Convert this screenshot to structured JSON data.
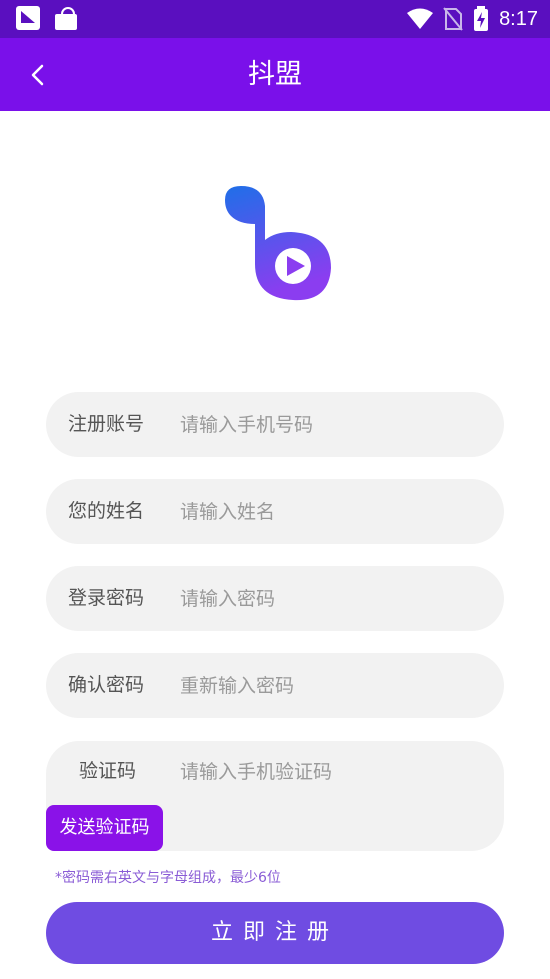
{
  "status_bar": {
    "time": "8:17",
    "left_icons": [
      "app-notification-icon",
      "shopping-bag-icon"
    ],
    "right_icons": [
      "wifi-icon",
      "no-sim-icon",
      "battery-charging-icon"
    ]
  },
  "header": {
    "title": "抖盟",
    "back_icon": "chevron-left-icon"
  },
  "form": {
    "account": {
      "label": "注册账号",
      "placeholder": "请输入手机号码",
      "value": ""
    },
    "name": {
      "label": "您的姓名",
      "placeholder": "请输入姓名",
      "value": ""
    },
    "password": {
      "label": "登录密码",
      "placeholder": "请输入密码",
      "value": ""
    },
    "confirm": {
      "label": "确认密码",
      "placeholder": "重新输入密码",
      "value": ""
    },
    "code": {
      "label": "验证码",
      "placeholder": "请输入手机验证码",
      "value": "",
      "send_label": "发送验证码"
    },
    "hint": "*密码需右英文与字母组成，最少6位",
    "submit_label": "立即注册"
  },
  "colors": {
    "status_bar": "#5a0fbf",
    "header": "#7a10ea",
    "field_bg": "#f2f2f2",
    "send_button": "#8a12e8",
    "submit_button": "#6f4ce2",
    "hint": "#8a5cd6"
  }
}
